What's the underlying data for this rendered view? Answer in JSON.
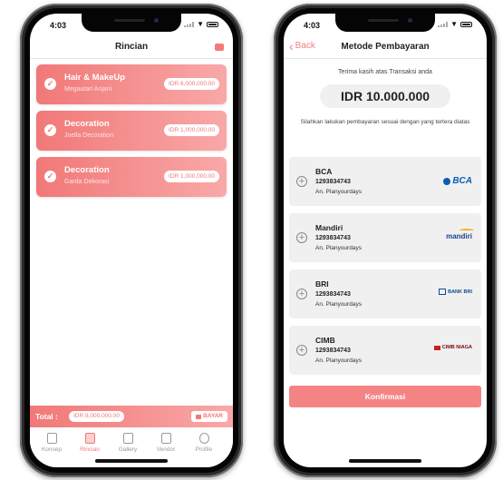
{
  "left_phone": {
    "status_time": "4:03",
    "title": "Rincian",
    "items": [
      {
        "title": "Hair & MakeUp",
        "vendor": "Megautari Anjani",
        "price": "IDR 6,000,000.00"
      },
      {
        "title": "Decoration",
        "vendor": "Joella Decoration",
        "price": "IDR 1,000,000.00"
      },
      {
        "title": "Decoration",
        "vendor": "Garda Dekorasi",
        "price": "IDR 1,000,000.00"
      }
    ],
    "total_label": "Total :",
    "total_value": "IDR 8,000,000.00",
    "pay_label": "BAYAR",
    "tabs": [
      {
        "label": "Konsep",
        "icon": "book-icon",
        "active": false
      },
      {
        "label": "Rincian",
        "icon": "list-icon",
        "active": true
      },
      {
        "label": "Gallery",
        "icon": "image-icon",
        "active": false
      },
      {
        "label": "Vendor",
        "icon": "trash-icon",
        "active": false
      },
      {
        "label": "Profile",
        "icon": "profile-icon",
        "active": false
      }
    ],
    "accent": "#f17878"
  },
  "right_phone": {
    "status_time": "4:03",
    "back_label": "Back",
    "title": "Metode Pembayaran",
    "thanks": "Terima kasih atas Transaksi anda",
    "total": "IDR 10.000.000",
    "instruction": "Silahkan lakukan pembayaran sesuai dengan yang tertera diatas",
    "banks": [
      {
        "name": "BCA",
        "account": "1293834743",
        "holder": "An. Planyourdays",
        "logo": "BCA"
      },
      {
        "name": "Mandiri",
        "account": "1293834743",
        "holder": "An. Planyourdays",
        "logo": "mandiri"
      },
      {
        "name": "BRI",
        "account": "1293834743",
        "holder": "An. Planyourdays",
        "logo": "BANK BRI"
      },
      {
        "name": "CIMB",
        "account": "1293834743",
        "holder": "An. Planyourdays",
        "logo": "CIMB NIAGA"
      }
    ],
    "confirm_label": "Konfirmasi",
    "accent": "#f48484"
  }
}
